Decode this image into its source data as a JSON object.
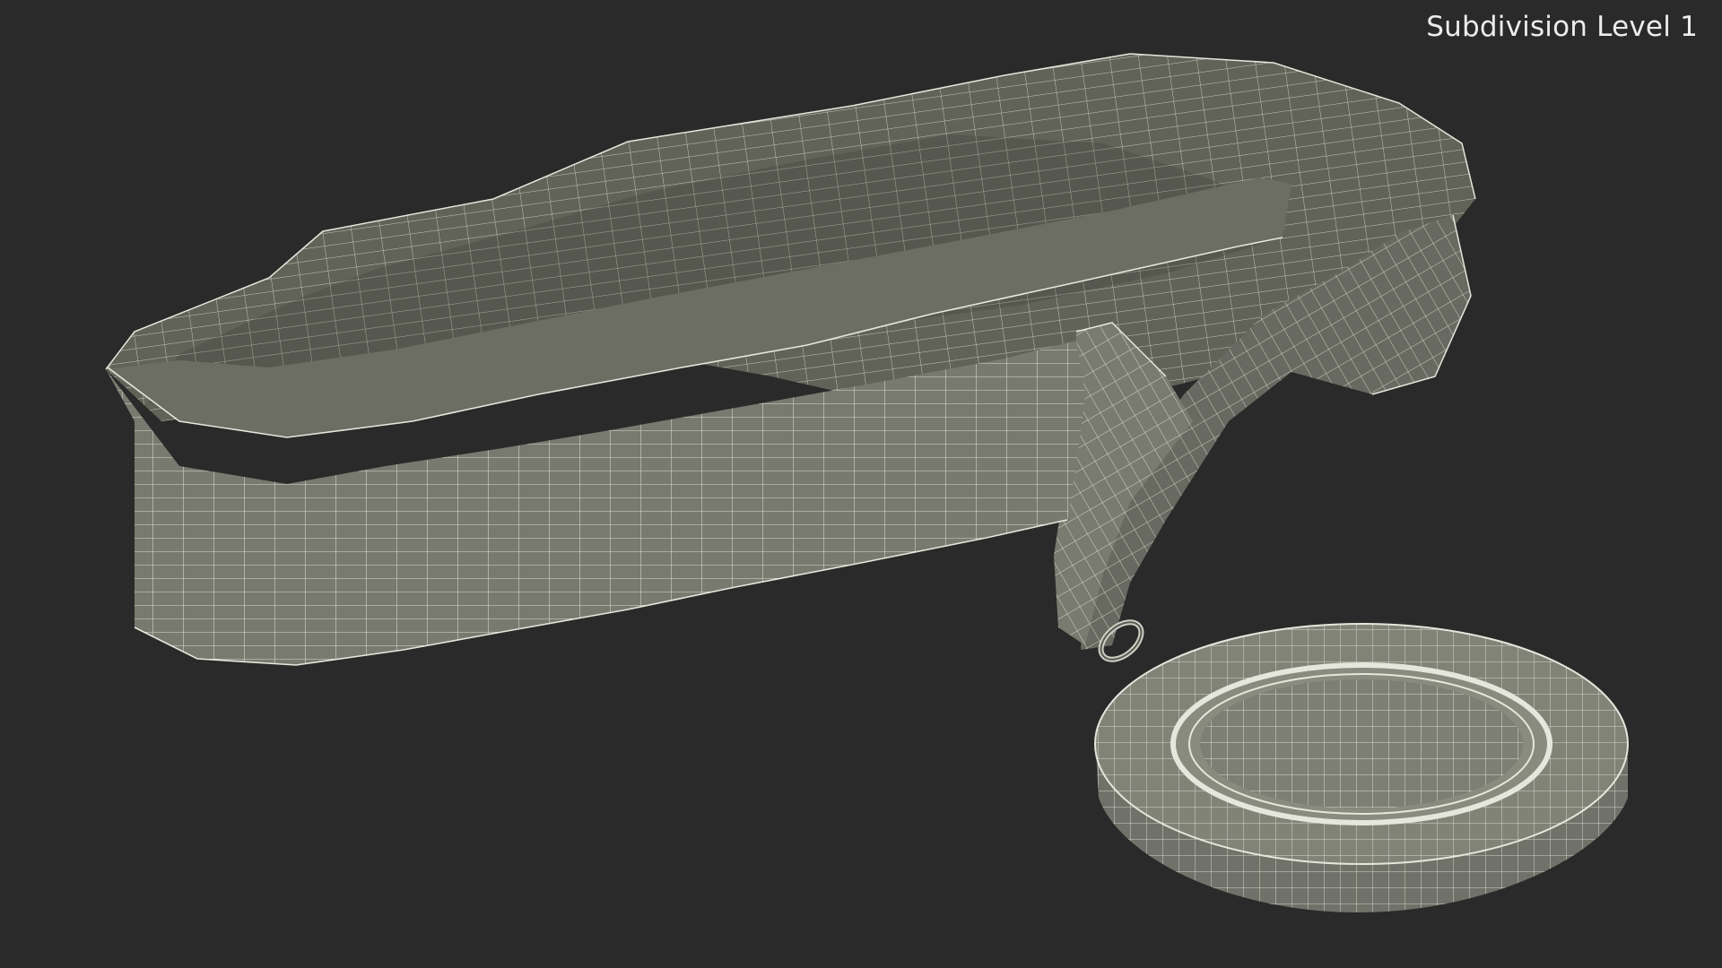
{
  "render_label": "Subdivision Level 1",
  "colors": {
    "background": "#2a2a2a",
    "surface_light": "#7a7a6e",
    "surface_mid": "#6a6b60",
    "surface_dark": "#55564d",
    "wire": "#e6e6dc"
  }
}
